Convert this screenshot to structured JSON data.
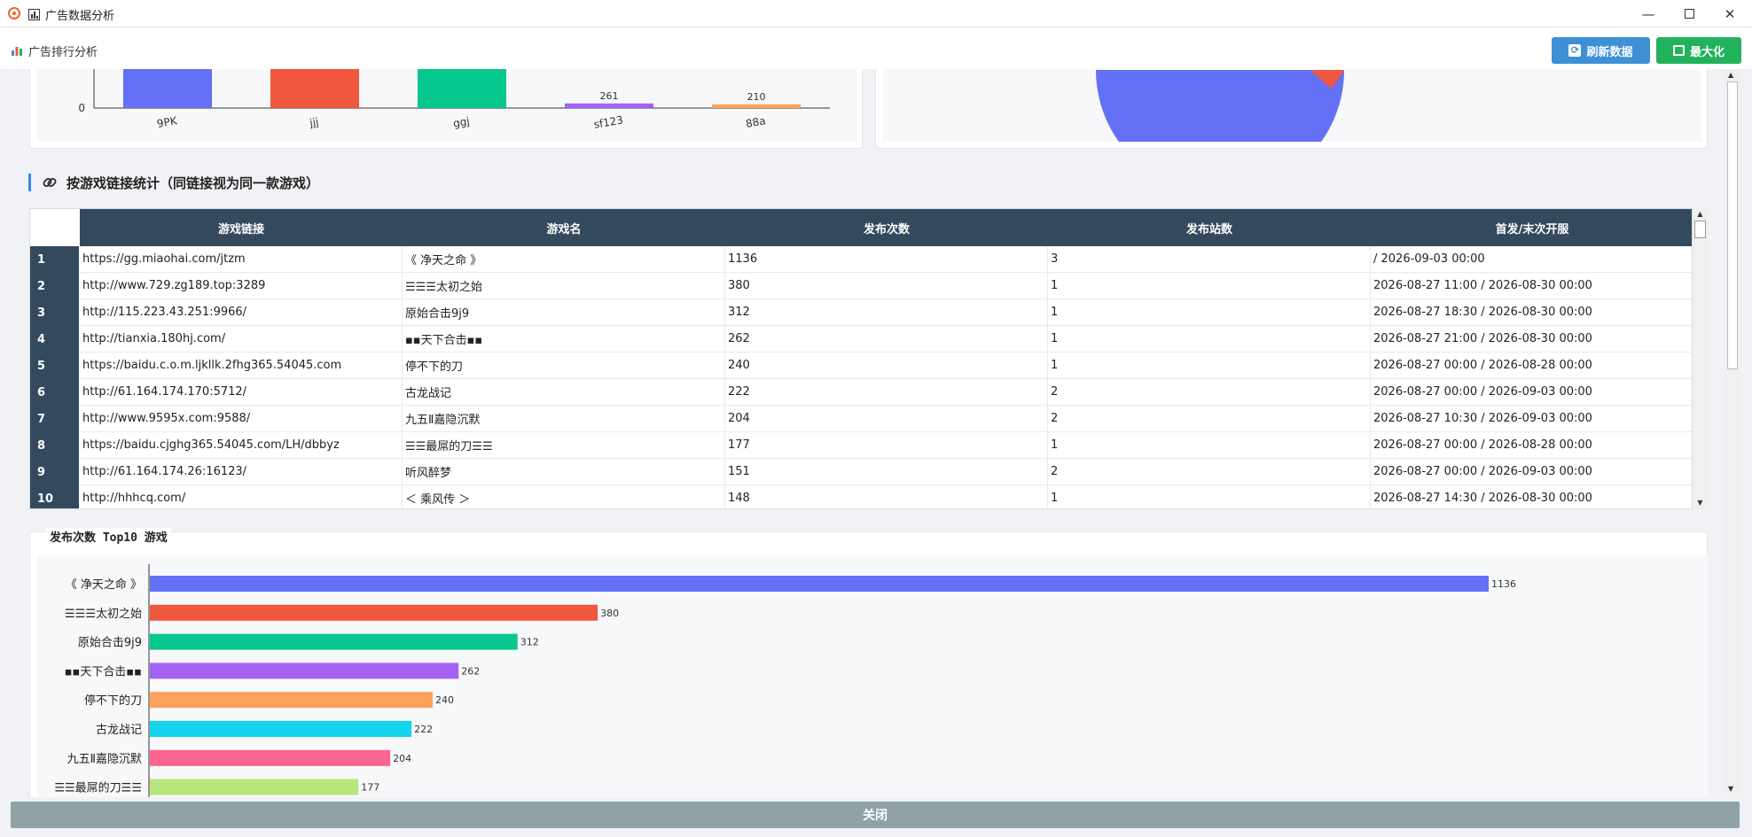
{
  "window": {
    "title": "广告数据分析",
    "minimize_icon": "minimize-icon",
    "maximize_icon": "maximize-icon",
    "close_icon": "close-icon"
  },
  "toolbar": {
    "section_label": "广告排行分析",
    "refresh_label": "刷新数据",
    "maximize_label": "最大化"
  },
  "top_chart": {
    "type": "bar",
    "y_tick_zero": "0",
    "y_tick_top": "2000",
    "categories": [
      "9PK",
      "jjj",
      "ggj",
      "sf123",
      "88a"
    ],
    "values": [
      null,
      null,
      null,
      261,
      210
    ],
    "value_labels": [
      "",
      "",
      "",
      "261",
      "210"
    ],
    "colors": [
      "#6470f5",
      "#f0573f",
      "#06c88e",
      "#a463f2",
      "#fda15b"
    ]
  },
  "section": {
    "title": "按游戏链接统计（同链接视为同一款游戏）"
  },
  "table": {
    "columns": [
      "游戏链接",
      "游戏名",
      "发布次数",
      "发布站数",
      "首发/末次开服"
    ],
    "rows": [
      {
        "idx": "1",
        "link": "https://gg.miaohai.com/jtzm",
        "name": "《 净天之命 》",
        "count": "1136",
        "sites": "3",
        "dates": " / 2026-09-03 00:00"
      },
      {
        "idx": "2",
        "link": "http://www.729.zg189.top:3289",
        "name": "☰☰☰太初之始",
        "count": "380",
        "sites": "1",
        "dates": "2026-08-27 11:00 / 2026-08-30 00:00"
      },
      {
        "idx": "3",
        "link": "http://115.223.43.251:9966/",
        "name": "原始合击9j9",
        "count": "312",
        "sites": "1",
        "dates": "2026-08-27 18:30 / 2026-08-30 00:00"
      },
      {
        "idx": "4",
        "link": "http://tianxia.180hj.com/",
        "name": "▪▪天下合击▪▪",
        "count": "262",
        "sites": "1",
        "dates": "2026-08-27 21:00 / 2026-08-30 00:00"
      },
      {
        "idx": "5",
        "link": "https://baidu.c.o.m.ljkllk.2fhg365.54045.com",
        "name": "停不下的刀",
        "count": "240",
        "sites": "1",
        "dates": "2026-08-27 00:00 / 2026-08-28 00:00"
      },
      {
        "idx": "6",
        "link": "http://61.164.174.170:5712/",
        "name": "古龙战记",
        "count": "222",
        "sites": "2",
        "dates": "2026-08-27 00:00 / 2026-09-03 00:00"
      },
      {
        "idx": "7",
        "link": "http://www.9595x.com:9588/",
        "name": "九五Ⅱ嘉隐沉默",
        "count": "204",
        "sites": "2",
        "dates": "2026-08-27 10:30 / 2026-09-03 00:00"
      },
      {
        "idx": "8",
        "link": "https://baidu.cjghg365.54045.com/LH/dbbyz",
        "name": "☰☰最屌的刀☰☰",
        "count": "177",
        "sites": "1",
        "dates": "2026-08-27 00:00 / 2026-08-28 00:00"
      },
      {
        "idx": "9",
        "link": "http://61.164.174.26:16123/",
        "name": "听风醉梦",
        "count": "151",
        "sites": "2",
        "dates": "2026-08-27 00:00 / 2026-09-03 00:00"
      },
      {
        "idx": "10",
        "link": "http://hhhcq.com/",
        "name": "＜ 乘风传 ＞",
        "count": "148",
        "sites": "1",
        "dates": "2026-08-27 14:30 / 2026-08-30 00:00"
      }
    ]
  },
  "bottom_chart_title": "发布次数 Top10 游戏",
  "chart_data": {
    "type": "bar",
    "orientation": "horizontal",
    "categories": [
      "《 净天之命 》",
      "☰☰☰太初之始",
      "原始合击9j9",
      "▪▪天下合击▪▪",
      "停不下的刀",
      "古龙战记",
      "九五Ⅱ嘉隐沉默",
      "☰☰最屌的刀☰☰"
    ],
    "values": [
      1136,
      380,
      312,
      262,
      240,
      222,
      204,
      177
    ],
    "colors": [
      "#6470f5",
      "#f0573f",
      "#06c88e",
      "#a463f2",
      "#fda15b",
      "#13d4ec",
      "#fc6491",
      "#b8e67d"
    ]
  },
  "footer": {
    "close_label": "关闭"
  }
}
